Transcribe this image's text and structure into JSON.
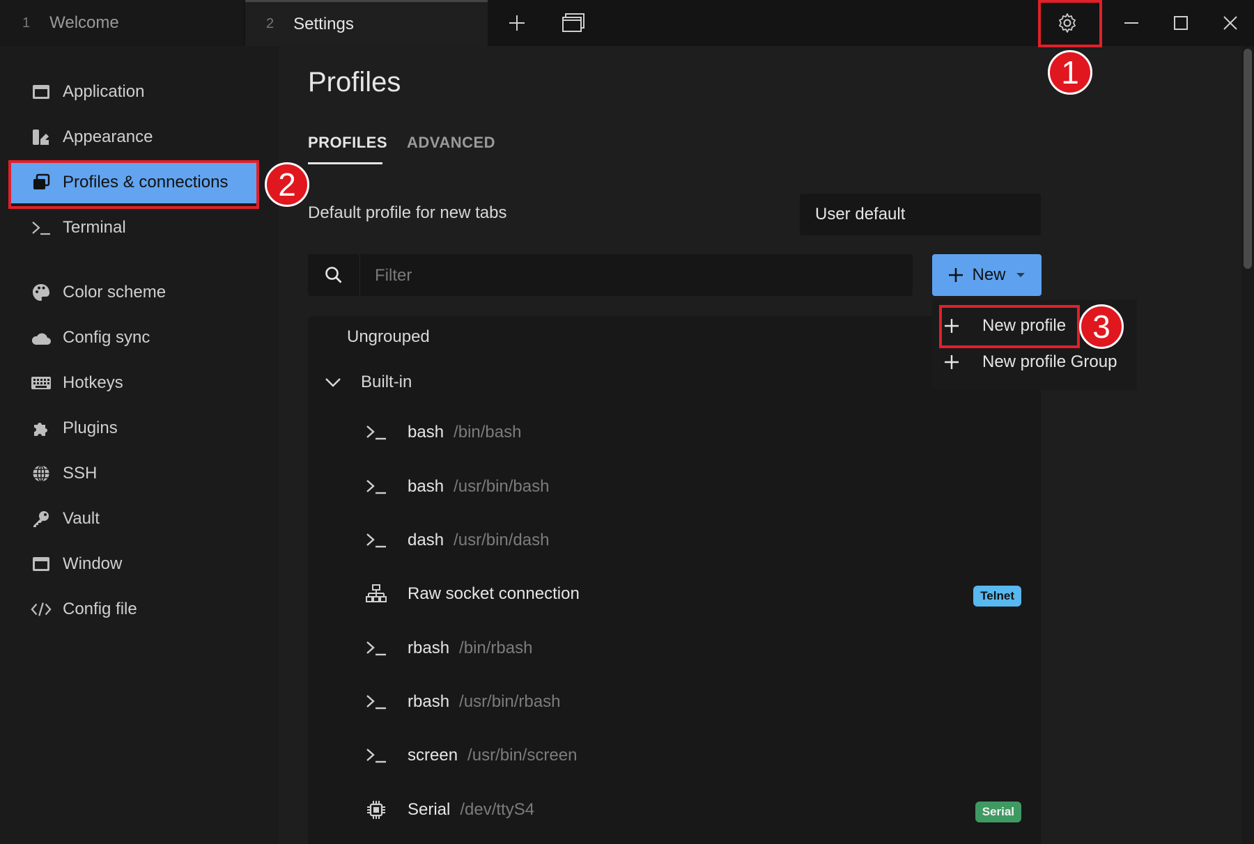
{
  "tabs": [
    {
      "num": "1",
      "label": "Welcome"
    },
    {
      "num": "2",
      "label": "Settings"
    }
  ],
  "annotations": {
    "one": "1",
    "two": "2",
    "three": "3"
  },
  "sidebar": {
    "items": [
      {
        "label": "Application",
        "icon": "window-icon"
      },
      {
        "label": "Appearance",
        "icon": "palette-brush-icon"
      },
      {
        "label": "Profiles & connections",
        "icon": "profiles-icon"
      },
      {
        "label": "Terminal",
        "icon": "terminal-icon"
      },
      {
        "label": "Color scheme",
        "icon": "color-palette-icon"
      },
      {
        "label": "Config sync",
        "icon": "cloud-icon"
      },
      {
        "label": "Hotkeys",
        "icon": "keyboard-icon"
      },
      {
        "label": "Plugins",
        "icon": "puzzle-icon"
      },
      {
        "label": "SSH",
        "icon": "globe-icon"
      },
      {
        "label": "Vault",
        "icon": "key-icon"
      },
      {
        "label": "Window",
        "icon": "window-icon"
      },
      {
        "label": "Config file",
        "icon": "code-icon"
      }
    ],
    "active": "Profiles & connections"
  },
  "main": {
    "title": "Profiles",
    "subtabs": [
      "PROFILES",
      "ADVANCED"
    ],
    "default_profile_label": "Default profile for new tabs",
    "default_profile_value": "User default",
    "filter_placeholder": "Filter",
    "new_button": "New",
    "dropdown": [
      "New profile",
      "New profile Group"
    ],
    "groups": {
      "ungrouped": "Ungrouped",
      "builtin": "Built-in"
    },
    "profiles": [
      {
        "name": "bash",
        "path": "/bin/bash",
        "icon": "terminal-icon",
        "tag": ""
      },
      {
        "name": "bash",
        "path": "/usr/bin/bash",
        "icon": "terminal-icon",
        "tag": ""
      },
      {
        "name": "dash",
        "path": "/usr/bin/dash",
        "icon": "terminal-icon",
        "tag": ""
      },
      {
        "name": "Raw socket connection",
        "path": "",
        "icon": "network-icon",
        "tag": "Telnet"
      },
      {
        "name": "rbash",
        "path": "/bin/rbash",
        "icon": "terminal-icon",
        "tag": ""
      },
      {
        "name": "rbash",
        "path": "/usr/bin/rbash",
        "icon": "terminal-icon",
        "tag": ""
      },
      {
        "name": "screen",
        "path": "/usr/bin/screen",
        "icon": "terminal-icon",
        "tag": ""
      },
      {
        "name": "Serial",
        "path": "/dev/ttyS4",
        "icon": "chip-icon",
        "tag": "Serial"
      }
    ]
  },
  "colors": {
    "accent": "#5ea2ef",
    "annotation_red": "#e0171f",
    "telnet_tag": "#58b8f0",
    "serial_tag": "#3f9a62"
  }
}
